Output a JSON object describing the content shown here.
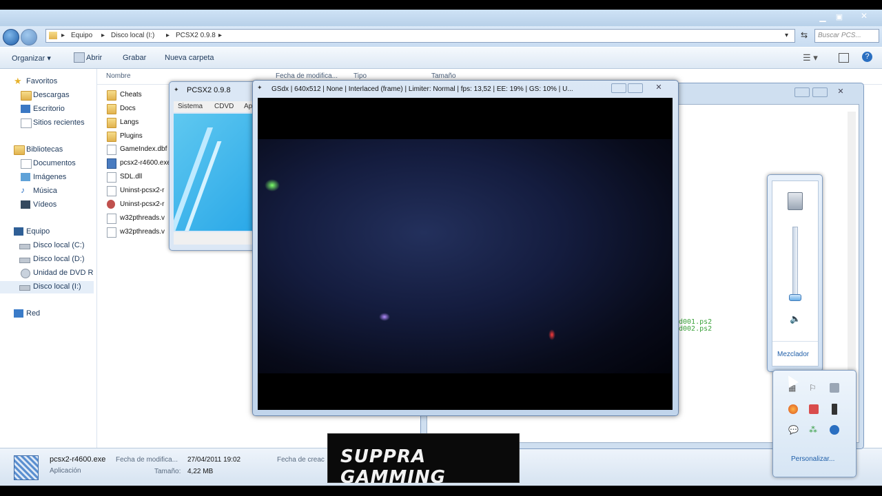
{
  "explorer": {
    "breadcrumb": [
      "Equipo",
      "Disco local (I:)",
      "PCSX2 0.9.8"
    ],
    "search_placeholder": "Buscar PCS...",
    "toolbar": {
      "organize": "Organizar ▾",
      "open": "Abrir",
      "burn": "Grabar",
      "new_folder": "Nueva carpeta"
    },
    "nav": {
      "favorites": "Favoritos",
      "fav_items": [
        "Descargas",
        "Escritorio",
        "Sitios recientes"
      ],
      "libraries": "Bibliotecas",
      "lib_items": [
        "Documentos",
        "Imágenes",
        "Música",
        "Vídeos"
      ],
      "computer": "Equipo",
      "drives": [
        "Disco local (C:)",
        "Disco local (D:)",
        "Unidad de DVD R",
        "Disco local (I:)"
      ],
      "network": "Red"
    },
    "columns": {
      "name": "Nombre",
      "modified": "Fecha de modifica...",
      "type": "Tipo",
      "size": "Tamaño"
    },
    "files": [
      "Cheats",
      "Docs",
      "Langs",
      "Plugins",
      "GameIndex.dbf",
      "pcsx2-r4600.exe",
      "SDL.dll",
      "Uninst-pcsx2-r",
      "Uninst-pcsx2-r",
      "w32pthreads.v",
      "w32pthreads.v"
    ],
    "details": {
      "filename": "pcsx2-r4600.exe",
      "type": "Aplicación",
      "modified_label": "Fecha de modifica...",
      "modified_value": "27/04/2011 19:02",
      "size_label": "Tamaño:",
      "size_value": "4,22 MB",
      "created_label": "Fecha de creac"
    }
  },
  "pcsx2": {
    "title": "PCSX2  0.9.8",
    "menu": [
      "Sistema",
      "CDVD",
      "Ap"
    ]
  },
  "gsdx": {
    "title": "GSdx | 640x512 | None | Interlaced (frame) | Limiter: Normal | fps: 13,52 | EE:  19% | GS:  10% | U..."
  },
  "console": {
    "lines": [
      "d001.ps2",
      "d002.ps2"
    ]
  },
  "volume": {
    "mixer_label": "Mezclador",
    "level": 0.04
  },
  "tray": {
    "customize_label": "Personalizar..."
  },
  "watermark": {
    "text": "SUPPRA GAMMING"
  },
  "colors": {
    "accent": "#1e395b",
    "window_frame": "#7f9cc1"
  }
}
